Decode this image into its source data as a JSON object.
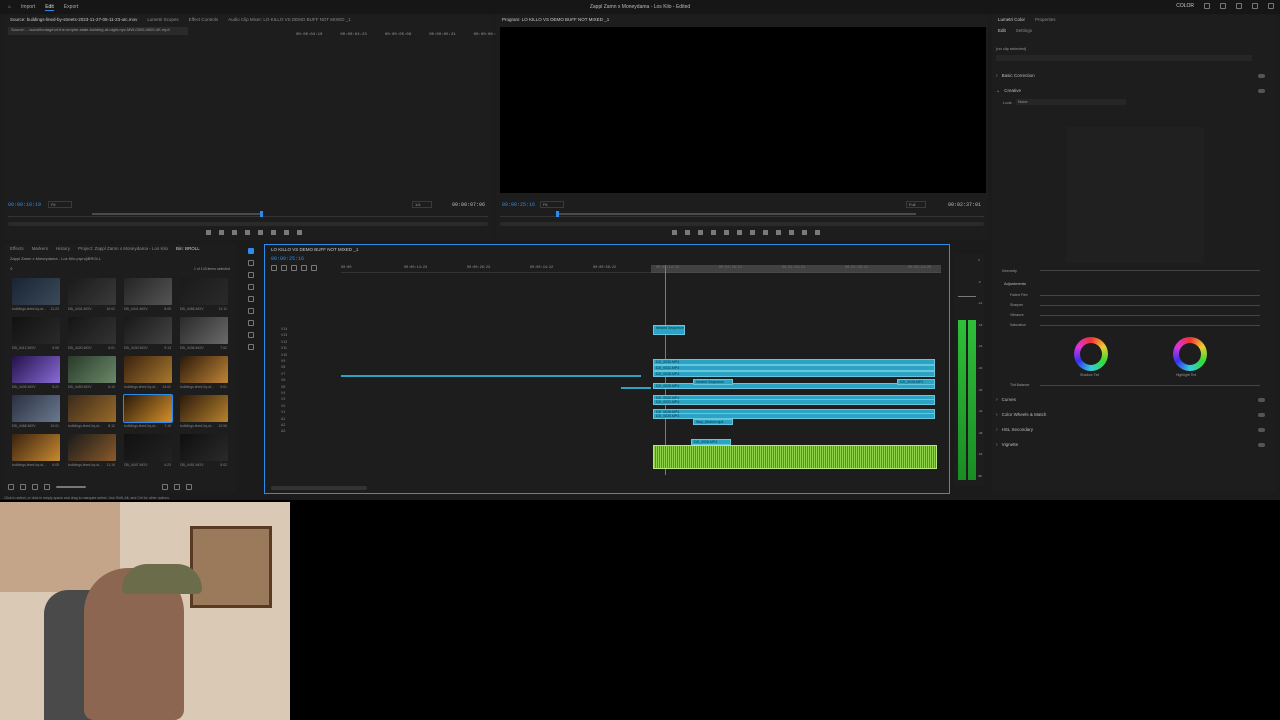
{
  "app": {
    "title": "Zappl Zamn x Moneydama - Los Kilo - Edited",
    "menu": [
      "Import",
      "Edit",
      "Export"
    ],
    "workspace": "COLOR"
  },
  "source": {
    "tabs": [
      "Source: buildings-lined-by-streets-2023-11-27-05-11-23-utc.mov",
      "Lumetri Scopes",
      "Effect Controls",
      "Audio Clip Mixer: LO KILLO VS DEMO BUFF NOT MIXED _1"
    ],
    "path": "Source: ...\\sand\\footage\\of-the-empire-state-building-at-night-nyc-MW-0500-0600-4K.mp4",
    "timecode": "00:00:10:19",
    "fit": "Fit",
    "quality": "1/4",
    "duration": "00:00:07:06",
    "ruler": [
      "00:00:04:10",
      "00:00:04:23",
      "00:00:05:08",
      "00:00:05:21",
      "00:00:06:11"
    ]
  },
  "program": {
    "tab": "Program: LO KILLO VS DEMO BUFF NOT MIXED _1",
    "timecode": "00:00:25:16",
    "fit": "Fit",
    "quality": "Full",
    "duration": "00:02:37:01"
  },
  "lumetri": {
    "tabs": [
      "Lumetri Color",
      "Properties"
    ],
    "subtabs": [
      "Edit",
      "Settings"
    ],
    "no_clip": "(no clip selected)",
    "sections": [
      "Basic Correction",
      "Creative",
      "Curves",
      "Color Wheels & Match",
      "HSL Secondary",
      "Vignette"
    ],
    "look_label": "Look",
    "look_value": "None",
    "intensity_label": "Intensity",
    "adjustments_label": "Adjustments",
    "sliders": [
      "Faded Film",
      "Sharpen",
      "Vibrance",
      "Saturation"
    ],
    "wheel_labels": [
      "Shadow Tint",
      "Highlight Tint"
    ],
    "tint_balance": "Tint Balance"
  },
  "project": {
    "tabs": [
      "Effects",
      "Markers",
      "History",
      "Project: Zappl Zamn x Moneydama - Los Kilo",
      "Bin: BROLL"
    ],
    "path": "Zappl Zamn x Moneydama - Los Kilo.prproj\\BROLL",
    "count": "1 of 143 items selected",
    "thumbs": [
      {
        "label": "buildings-lined-by-st...",
        "duration": "11:23",
        "colors": [
          "#1a2433",
          "#3a4a5a"
        ]
      },
      {
        "label": "DB_4431.MOV",
        "duration": "10:02",
        "colors": [
          "#1a1a1a",
          "#3a3a3a"
        ]
      },
      {
        "label": "DB_4441.MOV",
        "duration": "8:05",
        "colors": [
          "#242424",
          "#555"
        ]
      },
      {
        "label": "DB_4456.MOV",
        "duration": "11:11",
        "colors": [
          "#1a1a1a",
          "#2a2a2a"
        ]
      },
      {
        "label": "DB_4412.MOV",
        "duration": "5:08",
        "colors": [
          "#111",
          "#2a2a2a"
        ]
      },
      {
        "label": "DB_4420.MOV",
        "duration": "6:01",
        "colors": [
          "#151515",
          "#333"
        ]
      },
      {
        "label": "DB_4433.MOV",
        "duration": "9:13",
        "colors": [
          "#181818",
          "#444"
        ]
      },
      {
        "label": "DB_4436.MOV",
        "duration": "7:02",
        "colors": [
          "#2a2a2a",
          "#6a6a6a"
        ]
      },
      {
        "label": "DB_4406.MOV",
        "duration": "5:21",
        "colors": [
          "#23114a",
          "#8a6cd8"
        ]
      },
      {
        "label": "DB_4459.MOV",
        "duration": "6:10",
        "colors": [
          "#2a3a2a",
          "#6a8a6a"
        ]
      },
      {
        "label": "buildings-lined-by-st...",
        "duration": "14:02",
        "colors": [
          "#3a220f",
          "#a8782e"
        ]
      },
      {
        "label": "buildings-lined-by-st...",
        "duration": "9:01",
        "colors": [
          "#2a1a0a",
          "#c08436"
        ]
      },
      {
        "label": "DB_4468.MOV",
        "duration": "10:01",
        "colors": [
          "#2a3040",
          "#6a7a90"
        ]
      },
      {
        "label": "buildings-lined-by-st...",
        "duration": "8:12",
        "colors": [
          "#3a2a1a",
          "#9a6a2a"
        ]
      },
      {
        "label": "buildings-lined-by-st...",
        "duration": "7:19",
        "colors": [
          "#2a1a0a",
          "#d4902a"
        ]
      },
      {
        "label": "buildings-lined-by-st...",
        "duration": "12:06",
        "colors": [
          "#2a1a0a",
          "#b8822e"
        ]
      },
      {
        "label": "buildings-lined-by-st...",
        "duration": "6:05",
        "colors": [
          "#3a2210",
          "#c88a30"
        ]
      },
      {
        "label": "buildings-lined-by-st...",
        "duration": "11:19",
        "colors": [
          "#1a1a1a",
          "#8a5a2a"
        ]
      },
      {
        "label": "DB_4447.MOV",
        "duration": "4:23",
        "colors": [
          "#111",
          "#222"
        ]
      },
      {
        "label": "DB_4451.MOV",
        "duration": "5:02",
        "colors": [
          "#0f0f0f",
          "#2a2a2a"
        ]
      }
    ],
    "status": "Click to select, or click in empty space and drag to marquee select. Use Shift, Alt, and Ctrl for other options."
  },
  "timeline": {
    "tab": "LO KILLO VS DEMO BUFF NOT MIXED _1",
    "timecode": "00:00:25:16",
    "ruler": [
      "00:00",
      "00:00:14:23",
      "00:00:29:23",
      "00:00:44:22",
      "00:00:59:22",
      "00:01:14:22",
      "00:01:29:21",
      "00:01:44:21",
      "00:01:59:21",
      "00:02:14:20"
    ],
    "video_tracks": [
      "V14",
      "V13",
      "V12",
      "V11",
      "V10",
      "V9",
      "V8",
      "V7",
      "V6",
      "V5",
      "V4",
      "V3",
      "V2",
      "V1"
    ],
    "audio_tracks": [
      "A1",
      "A2",
      "A3"
    ],
    "audio_label": "Audio 1",
    "clip_names": [
      "DJI_0030.MP4",
      "DJI_0031.MP4",
      "DJI_0028.MP4",
      "DJI_0025.MP4",
      "Nested Sequence",
      "Stop_Motion.mp4",
      "DJI_0026.MP4"
    ]
  },
  "meter_labels": [
    "0",
    "-6",
    "-12",
    "-18",
    "-24",
    "-30",
    "-36",
    "-42",
    "-48",
    "-54",
    "dB"
  ],
  "colors": {
    "accent": "#2d8ceb",
    "clip": "#2aa3c4",
    "audio": "#8fd34a"
  }
}
